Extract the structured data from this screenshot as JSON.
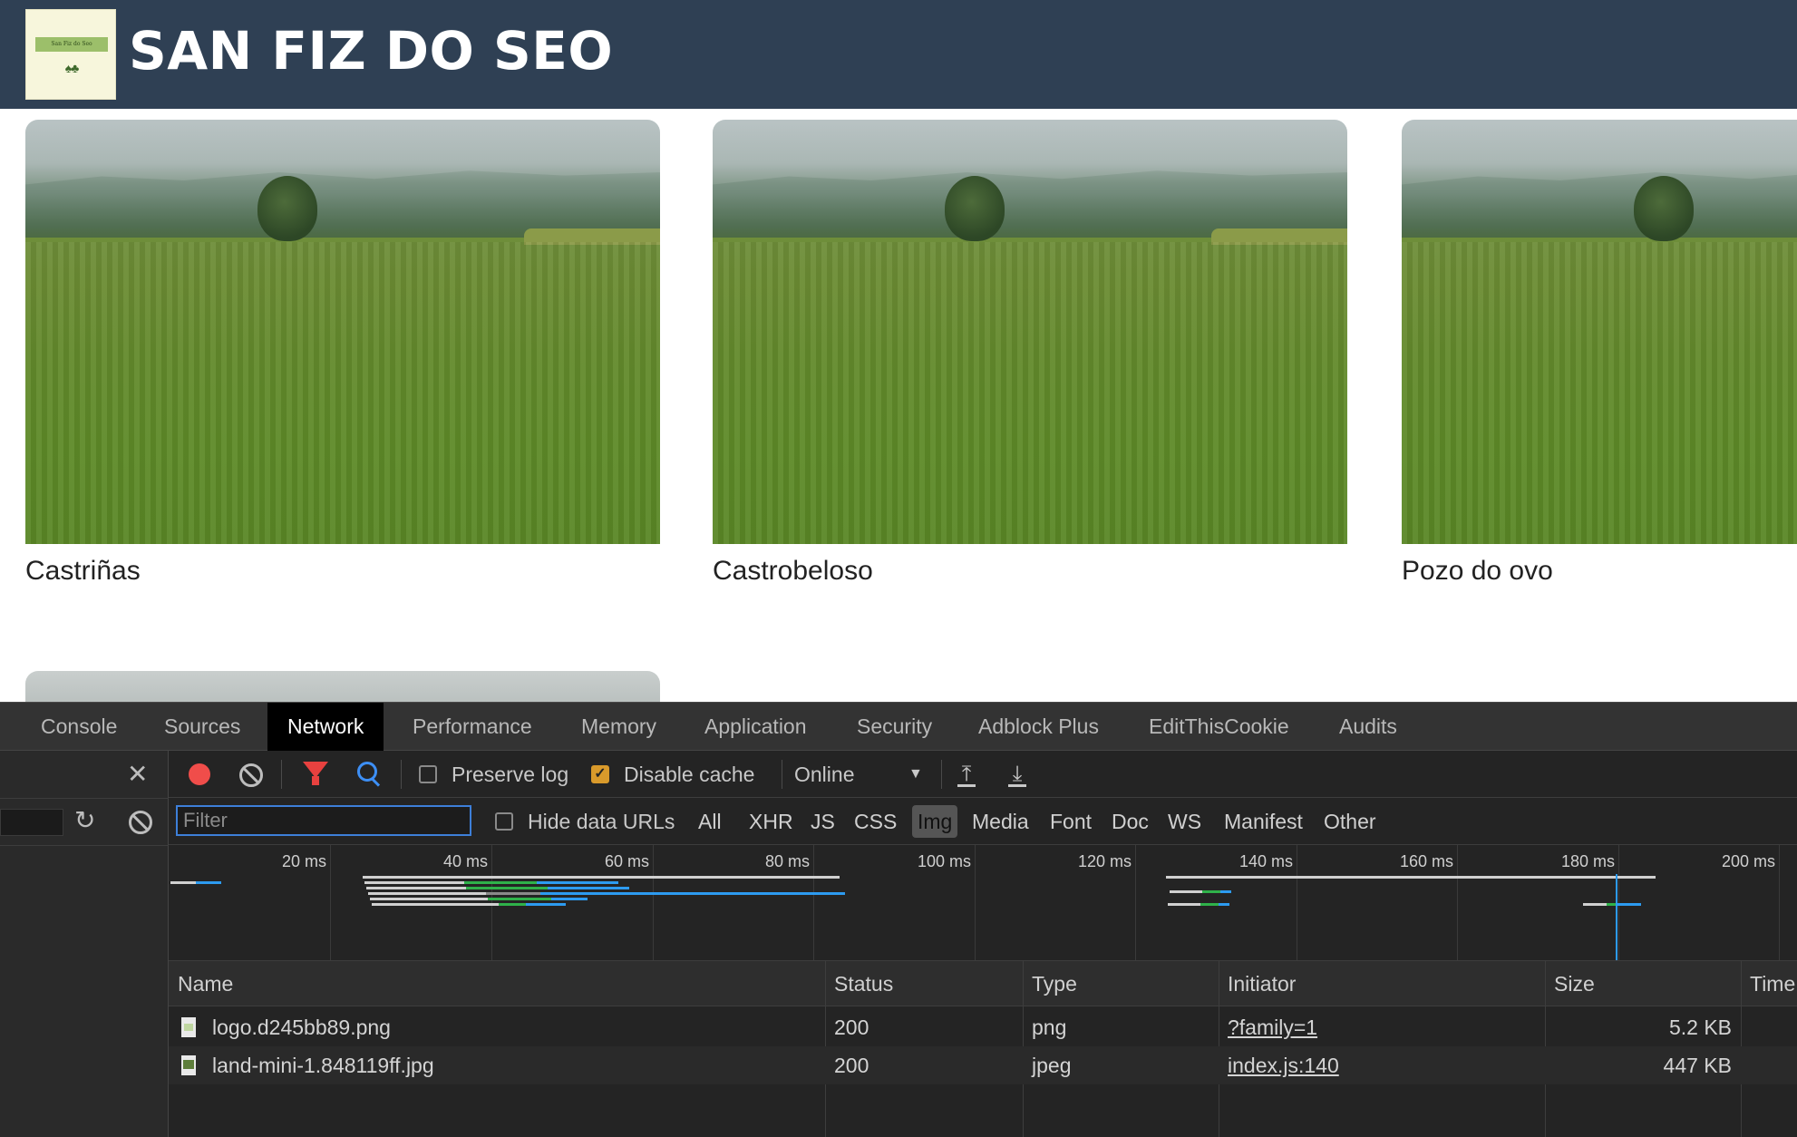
{
  "site": {
    "title": "SAN FIZ DO SEO",
    "logo_text": "San Fiz do Seo",
    "logo_trees": "♠♣"
  },
  "cards": [
    {
      "caption": "Castriñas"
    },
    {
      "caption": "Castrobeloso"
    },
    {
      "caption": "Pozo do ovo"
    }
  ],
  "devtools": {
    "tabs": [
      "Console",
      "Sources",
      "Network",
      "Performance",
      "Memory",
      "Application",
      "Security",
      "Adblock Plus",
      "EditThisCookie",
      "Audits"
    ],
    "active_tab": "Network",
    "toolbar": {
      "preserve_log": "Preserve log",
      "preserve_log_checked": false,
      "disable_cache": "Disable cache",
      "disable_cache_checked": true,
      "throttle": "Online",
      "throttle_caret": "▼",
      "upload_arrow": "⤒",
      "download_arrow": "⤓",
      "close_glyph": "✕",
      "reload_glyph": "↻"
    },
    "filter": {
      "placeholder": "Filter",
      "hide_data_urls": "Hide data URLs",
      "types": [
        "All",
        "XHR",
        "JS",
        "CSS",
        "Img",
        "Media",
        "Font",
        "Doc",
        "WS",
        "Manifest",
        "Other"
      ],
      "active_type": "Img"
    },
    "timeline": {
      "ticks": [
        "20 ms",
        "40 ms",
        "60 ms",
        "80 ms",
        "100 ms",
        "120 ms",
        "140 ms",
        "160 ms",
        "180 ms",
        "200 ms"
      ],
      "colors": {
        "waiting": "#d0d0d0",
        "stalled": "#8a8a8a",
        "ttfb": "#2fb24a",
        "download": "#2d9bf0",
        "marker": "#2d9bf0"
      }
    },
    "table": {
      "columns": [
        "Name",
        "Status",
        "Type",
        "Initiator",
        "Size",
        "Time"
      ],
      "rows": [
        {
          "name": "logo.d245bb89.png",
          "status": "200",
          "type": "png",
          "initiator": "?family=1",
          "size": "5.2 KB",
          "icon": "png-file-icon"
        },
        {
          "name": "land-mini-1.848119ff.jpg",
          "status": "200",
          "type": "jpeg",
          "initiator": "index.js:140",
          "size": "447 KB",
          "icon": "jpg-file-icon"
        }
      ]
    }
  }
}
